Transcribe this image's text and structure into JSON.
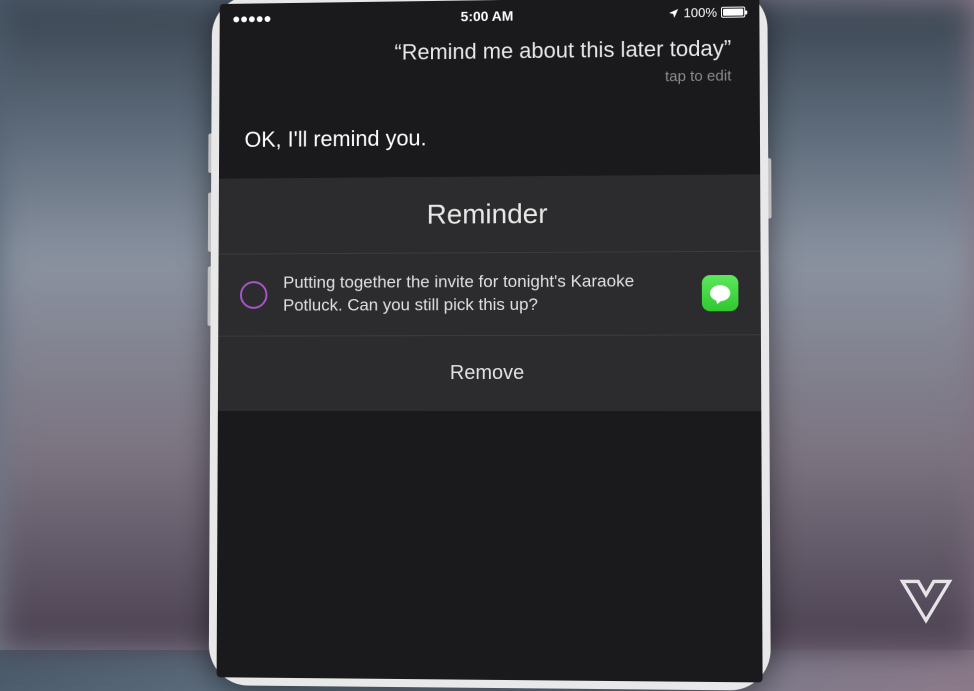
{
  "status_bar": {
    "time": "5:00 AM",
    "battery_percent": "100%",
    "signal_dots": 5
  },
  "siri": {
    "query": "“Remind me about this later today”",
    "tap_hint": "tap to edit",
    "response": "OK, I'll remind you."
  },
  "reminder": {
    "title": "Reminder",
    "item_text": "Putting together the invite for tonight's Karaoke Potluck. Can you still pick this up?",
    "app_icon": "messages",
    "remove_label": "Remove"
  }
}
